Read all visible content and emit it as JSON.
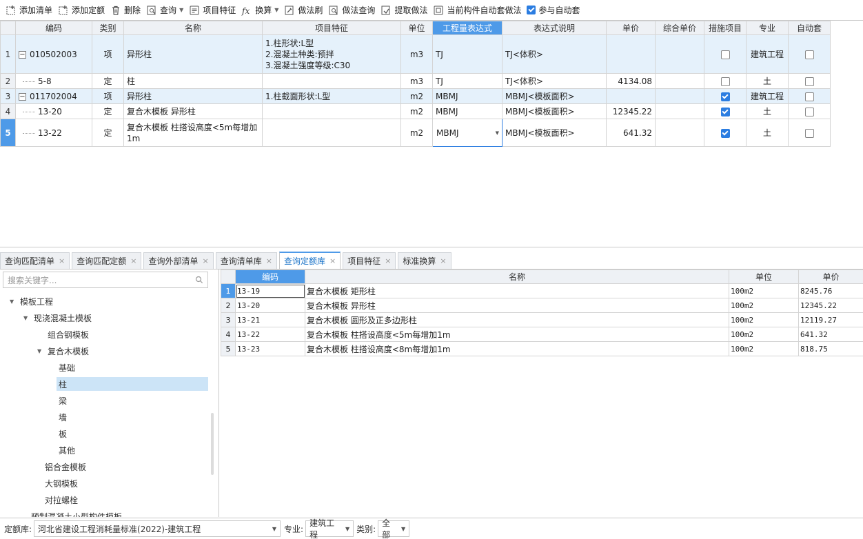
{
  "toolbar": {
    "add_list": "添加清单",
    "add_quota": "添加定额",
    "delete": "删除",
    "query": "查询",
    "item_feature": "项目特征",
    "convert": "换算",
    "method_brush": "做法刷",
    "method_query": "做法查询",
    "extract_method": "提取做法",
    "auto_set_current": "当前构件自动套做法",
    "join_auto_set": "参与自动套",
    "join_auto_set_checked": true
  },
  "top_grid": {
    "headers": [
      "编码",
      "类别",
      "名称",
      "项目特征",
      "单位",
      "工程量表达式",
      "表达式说明",
      "单价",
      "综合单价",
      "措施项目",
      "专业",
      "自动套"
    ],
    "rows": [
      {
        "num": "1",
        "code": "010502003",
        "type": "项",
        "name": "异形柱",
        "feature": "1.柱形状:L型\n2.混凝土种类:预拌\n3.混凝土强度等级:C30",
        "unit": "m3",
        "expr": "TJ",
        "expr_desc": "TJ<体积>",
        "price": "",
        "total_price": "",
        "measure": false,
        "major": "建筑工程",
        "auto": false
      },
      {
        "num": "2",
        "code": "5-8",
        "type": "定",
        "name": "柱",
        "feature": "",
        "unit": "m3",
        "expr": "TJ",
        "expr_desc": "TJ<体积>",
        "price": "4134.08",
        "total_price": "",
        "measure": false,
        "major": "土",
        "auto": false
      },
      {
        "num": "3",
        "code": "011702004",
        "type": "项",
        "name": "异形柱",
        "feature": "1.柱截面形状:L型",
        "unit": "m2",
        "expr": "MBMJ",
        "expr_desc": "MBMJ<模板面积>",
        "price": "",
        "total_price": "",
        "measure": true,
        "major": "建筑工程",
        "auto": false
      },
      {
        "num": "4",
        "code": "13-20",
        "type": "定",
        "name": "复合木模板 异形柱",
        "feature": "",
        "unit": "m2",
        "expr": "MBMJ",
        "expr_desc": "MBMJ<模板面积>",
        "price": "12345.22",
        "total_price": "",
        "measure": true,
        "major": "土",
        "auto": false
      },
      {
        "num": "5",
        "code": "13-22",
        "type": "定",
        "name": "复合木模板 柱搭设高度<5m每增加1m",
        "feature": "",
        "unit": "m2",
        "expr": "MBMJ",
        "expr_desc": "MBMJ<模板面积>",
        "price": "641.32",
        "total_price": "",
        "measure": true,
        "major": "土",
        "auto": false
      }
    ]
  },
  "tabs": [
    {
      "label": "查询匹配清单",
      "active": false
    },
    {
      "label": "查询匹配定额",
      "active": false
    },
    {
      "label": "查询外部清单",
      "active": false
    },
    {
      "label": "查询清单库",
      "active": false
    },
    {
      "label": "查询定额库",
      "active": true
    },
    {
      "label": "项目特征",
      "active": false
    },
    {
      "label": "标准换算",
      "active": false
    }
  ],
  "search": {
    "placeholder": "搜索关键字..."
  },
  "tree": [
    {
      "label": "模板工程",
      "level": 0,
      "expanded": true
    },
    {
      "label": "现浇混凝土模板",
      "level": 1,
      "expanded": true
    },
    {
      "label": "组合钢模板",
      "level": 2
    },
    {
      "label": "复合木模板",
      "level": 2,
      "expanded": true
    },
    {
      "label": "基础",
      "level": 3
    },
    {
      "label": "柱",
      "level": 3,
      "selected": true
    },
    {
      "label": "梁",
      "level": 3
    },
    {
      "label": "墙",
      "level": 3
    },
    {
      "label": "板",
      "level": 3
    },
    {
      "label": "其他",
      "level": 3
    },
    {
      "label": "铝合金模板",
      "level": 2
    },
    {
      "label": "大钢模板",
      "level": 2
    },
    {
      "label": "对拉螺栓",
      "level": 2
    },
    {
      "label": "预制混凝土小型构件模板",
      "level": 1
    }
  ],
  "right_grid": {
    "headers": [
      "编码",
      "名称",
      "单位",
      "单价"
    ],
    "rows": [
      {
        "num": "1",
        "code": "13-19",
        "name": "复合木模板 矩形柱",
        "unit": "100m2",
        "price": "8245.76"
      },
      {
        "num": "2",
        "code": "13-20",
        "name": "复合木模板 异形柱",
        "unit": "100m2",
        "price": "12345.22"
      },
      {
        "num": "3",
        "code": "13-21",
        "name": "复合木模板 圆形及正多边形柱",
        "unit": "100m2",
        "price": "12119.27"
      },
      {
        "num": "4",
        "code": "13-22",
        "name": "复合木模板 柱搭设高度<5m每增加1m",
        "unit": "100m2",
        "price": "641.32"
      },
      {
        "num": "5",
        "code": "13-23",
        "name": "复合木模板 柱搭设高度<8m每增加1m",
        "unit": "100m2",
        "price": "818.75"
      }
    ]
  },
  "bottom": {
    "library_label": "定额库:",
    "library_value": "河北省建设工程消耗量标准(2022)-建筑工程",
    "major_label": "专业:",
    "major_value": "建筑工程",
    "category_label": "类别:",
    "category_value": "全部"
  },
  "colors": {
    "accent": "#4e9ae8",
    "row_highlight": "#e5f1fb",
    "check_blue": "#2b7de1"
  }
}
